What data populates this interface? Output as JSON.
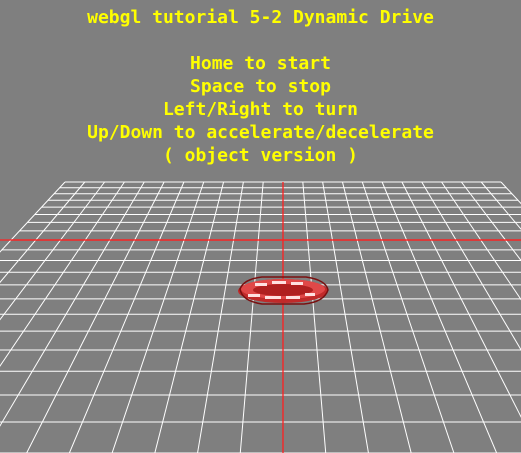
{
  "title": "webgl tutorial 5-2 Dynamic Drive",
  "instructions": [
    "Home to start",
    "Space to stop",
    "Left/Right to turn",
    "Up/Down to accelerate/decelerate",
    "( object version )"
  ],
  "colors": {
    "background": "#7f7f7f",
    "text": "#ffff00",
    "grid": "#ffffff",
    "axis": "#ff2020",
    "boat": "#d83a3a",
    "boat_highlight": "#ffe0e0"
  },
  "scene": {
    "grid": "white line grid on ground plane, perspective view",
    "axes": "red center axes",
    "object": "red inflatable boat"
  }
}
